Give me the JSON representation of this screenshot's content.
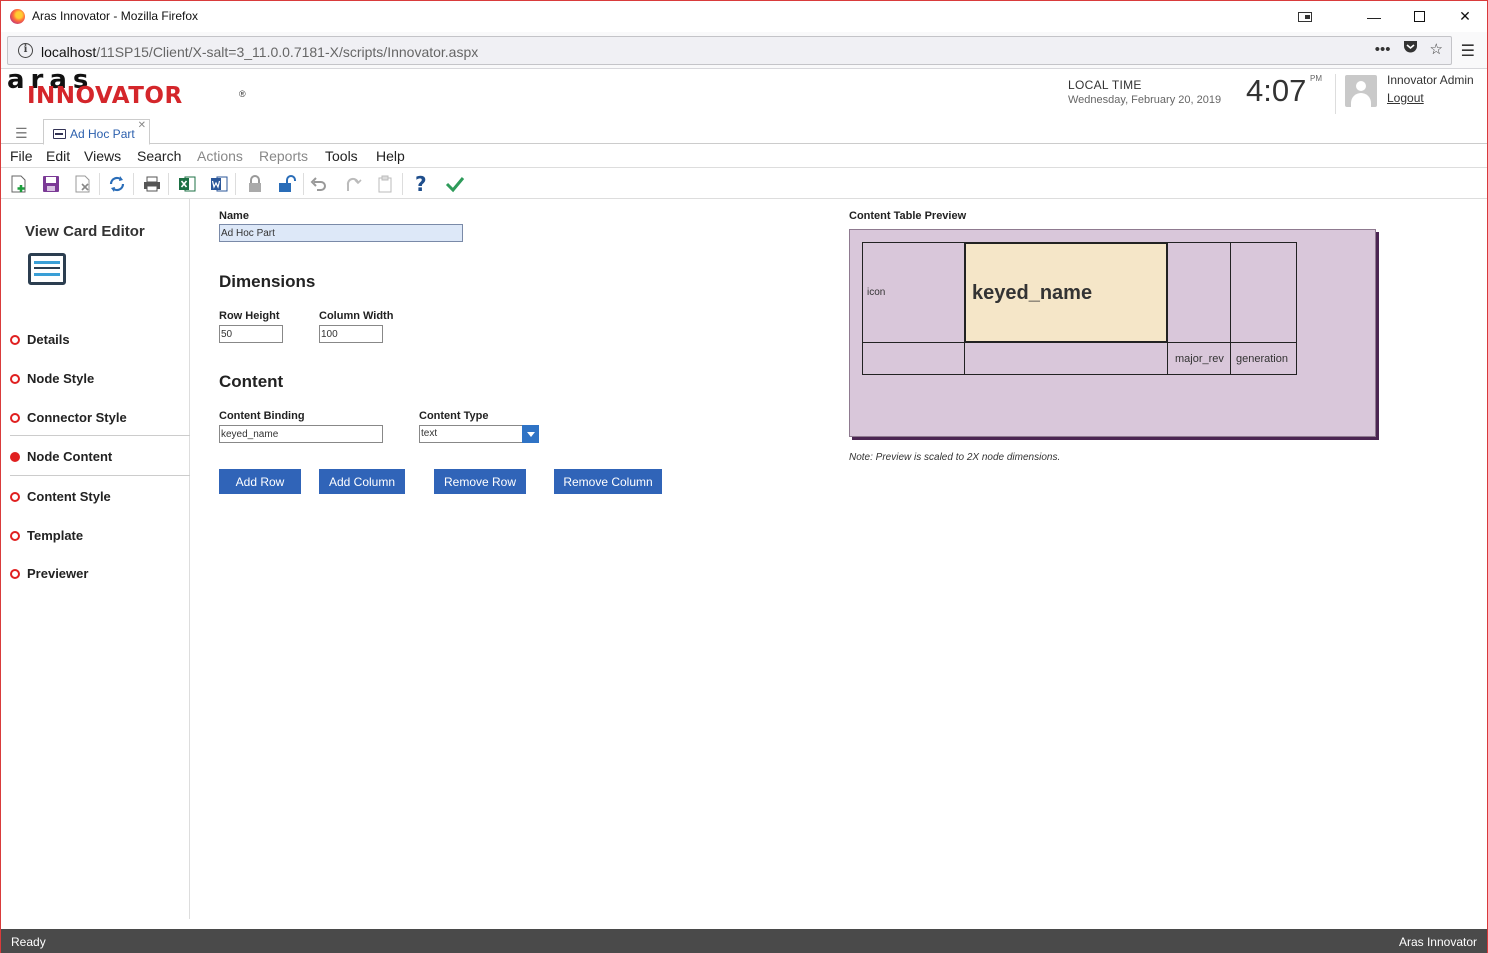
{
  "window": {
    "title": "Aras Innovator - Mozilla Firefox",
    "url_prefix": "localhost",
    "url_rest": "/11SP15/Client/X-salt=3_11.0.0.7181-X/scripts/Innovator.aspx"
  },
  "header": {
    "logo_top": "aras",
    "logo_bottom": "INNOVATOR",
    "logo_reg": "®",
    "local_time_label": "LOCAL TIME",
    "date": "Wednesday, February 20, 2019",
    "time": "4:07",
    "ampm": "PM",
    "user_name": "Innovator Admin",
    "logout_label": "Logout"
  },
  "tabs": [
    {
      "label": "Ad Hoc Part"
    }
  ],
  "menubar": {
    "items": [
      "File",
      "Edit",
      "Views",
      "Search",
      "Actions",
      "Reports",
      "Tools",
      "Help"
    ],
    "disabled": [
      "Actions",
      "Reports"
    ]
  },
  "toolbar": {
    "icons": [
      "new-icon",
      "save-icon",
      "close-item-icon",
      "refresh-icon",
      "print-icon",
      "excel-icon",
      "word-icon",
      "lock-icon",
      "unlock-icon",
      "undo-icon",
      "redo-icon",
      "paste-icon",
      "help-icon",
      "done-icon"
    ]
  },
  "sidebar": {
    "title": "View Card Editor",
    "items": [
      {
        "label": "Details",
        "active": false
      },
      {
        "label": "Node Style",
        "active": false
      },
      {
        "label": "Connector Style",
        "active": false
      },
      {
        "label": "Node Content",
        "active": true
      },
      {
        "label": "Content Style",
        "active": false
      },
      {
        "label": "Template",
        "active": false
      },
      {
        "label": "Previewer",
        "active": false
      }
    ]
  },
  "form": {
    "name_label": "Name",
    "name_value": "Ad Hoc Part",
    "dimensions_title": "Dimensions",
    "row_height_label": "Row Height",
    "row_height_value": "50",
    "column_width_label": "Column Width",
    "column_width_value": "100",
    "content_title": "Content",
    "content_binding_label": "Content Binding",
    "content_binding_value": "keyed_name",
    "content_type_label": "Content Type",
    "content_type_value": "text",
    "buttons": {
      "add_row": "Add Row",
      "add_column": "Add Column",
      "remove_row": "Remove Row",
      "remove_column": "Remove Column"
    }
  },
  "preview": {
    "title": "Content Table Preview",
    "cells": {
      "icon": "icon",
      "keyed_name": "keyed_name",
      "major_rev": "major_rev",
      "generation": "generation"
    },
    "note": "Note: Preview is scaled to 2X node dimensions.",
    "colors": {
      "background": "#d9c7da",
      "selected_cell": "#f5e6c8"
    }
  },
  "status": {
    "left": "Ready",
    "right": "Aras Innovator"
  }
}
